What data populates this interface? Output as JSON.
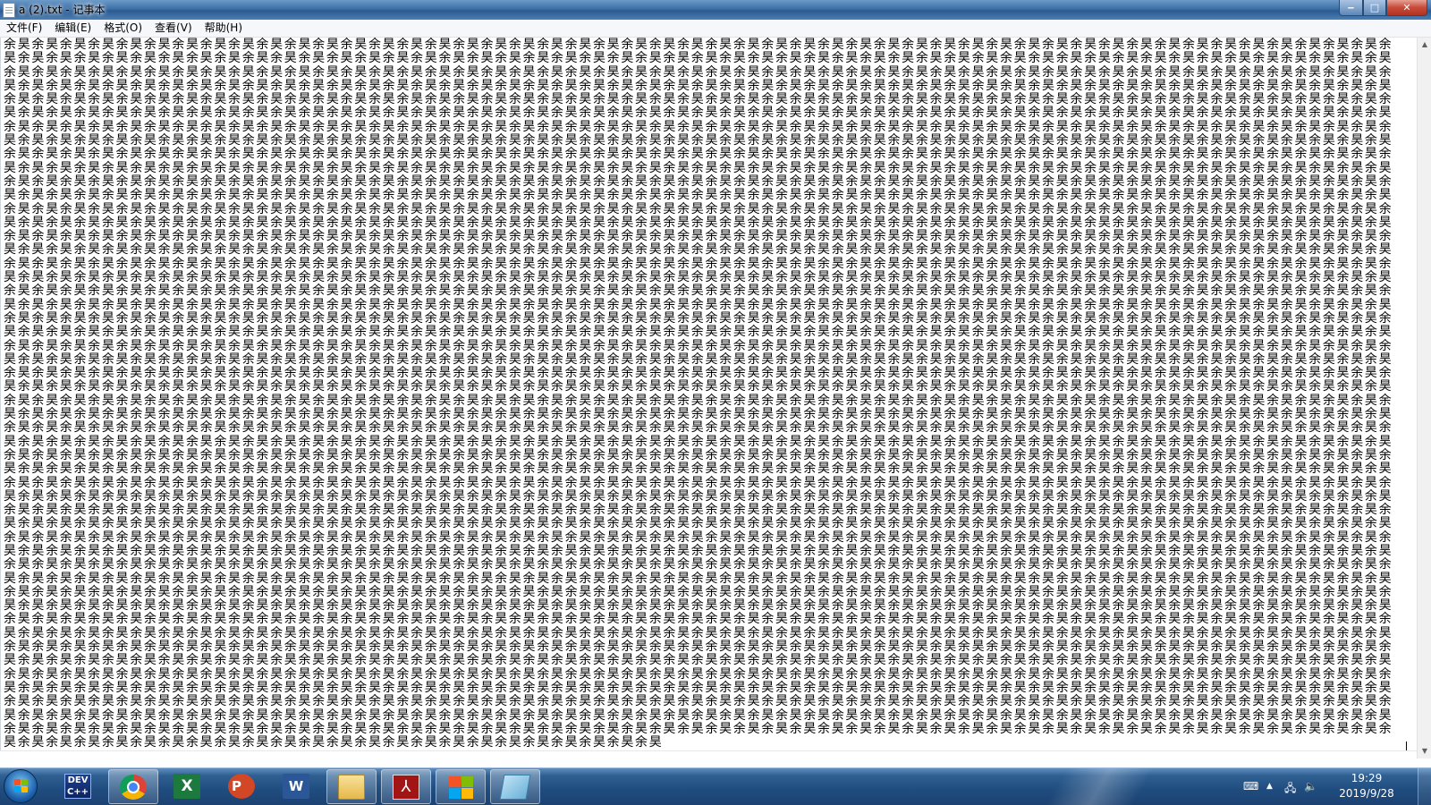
{
  "window": {
    "title": "a (2).txt - 记事本",
    "controls": {
      "minimize": "‒",
      "maximize": "□",
      "close": "✕"
    }
  },
  "menu": {
    "items": [
      "文件(F)",
      "编辑(E)",
      "格式(O)",
      "查看(V)",
      "帮助(H)"
    ]
  },
  "editor": {
    "repeated_text": "余昊",
    "visible_lines": 52,
    "chars_per_line": 98
  },
  "taskbar": {
    "pinned_icons": [
      "dev-cpp-icon",
      "chrome-icon",
      "excel-icon",
      "powerpoint-icon",
      "word-icon",
      "file-explorer-icon",
      "adobe-reader-icon",
      "microsoft-store-icon",
      "notepad-icon"
    ],
    "dev_label": "DEV",
    "excel_label": "X",
    "ppt_label": "P",
    "word_label": "W",
    "clock": {
      "time": "19:29",
      "date": "2019/9/28"
    }
  },
  "colors": {
    "titlebar": "#3d6fa6",
    "taskbar": "#1f4c7e",
    "close_button": "#c74a38"
  }
}
